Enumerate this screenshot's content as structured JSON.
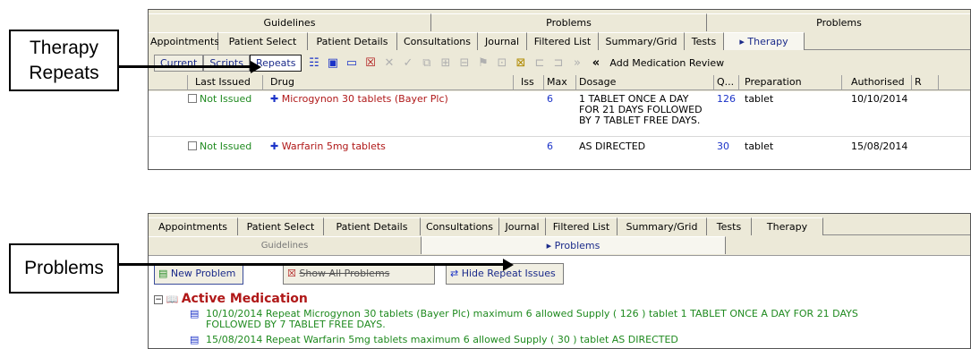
{
  "callouts": {
    "therapy_repeats": "Therapy Repeats",
    "problems": "Problems"
  },
  "top_panel": {
    "upper_tabs": [
      "Guidelines",
      "Problems",
      "Problems"
    ],
    "lower_tabs": [
      "Appointments",
      "Patient Select",
      "Patient Details",
      "Consultations",
      "Journal",
      "Filtered List",
      "Summary/Grid",
      "Tests",
      "▸ Therapy"
    ],
    "subtabs": {
      "current": "Current",
      "scripts": "Scripts",
      "repeats": "Repeats"
    },
    "add_review_label": "Add Medication Review",
    "columns": [
      "Last Issued",
      "Drug",
      "Iss",
      "Max",
      "Dosage",
      "Q...",
      "Preparation",
      "Authorised",
      "R"
    ],
    "rows": [
      {
        "status": "Not Issued",
        "drug": "Microgynon 30 tablets (Bayer Plc)",
        "max": "6",
        "dosage_lines": [
          "1 TABLET ONCE A DAY",
          "FOR 21 DAYS FOLLOWED",
          "BY 7 TABLET FREE DAYS."
        ],
        "quantity": "126",
        "preparation": "tablet",
        "authorised": "10/10/2014"
      },
      {
        "status": "Not Issued",
        "drug": "Warfarin 5mg tablets",
        "max": "6",
        "dosage_lines": [
          "AS DIRECTED"
        ],
        "quantity": "30",
        "preparation": "tablet",
        "authorised": "15/08/2014"
      }
    ]
  },
  "bottom_panel": {
    "tabs": [
      "Appointments",
      "Patient Select",
      "Patient Details",
      "Consultations",
      "Journal",
      "Filtered List",
      "Summary/Grid",
      "Tests",
      "Therapy"
    ],
    "second_row": {
      "guidelines": "Guidelines",
      "problems": "▸ Problems"
    },
    "buttons": {
      "new_problem": "New Problem",
      "show_all": "Show All Problems",
      "hide_repeat": "Hide Repeat Issues"
    },
    "section_title": "Active Medication",
    "entries": [
      {
        "line1": "10/10/2014 Repeat  Microgynon 30 tablets (Bayer Plc)  maximum  6  allowed  Supply ( 126 ) tablet  1 TABLET ONCE A DAY  FOR 21 DAYS",
        "line2": "FOLLOWED BY 7 TABLET FREE DAYS."
      },
      {
        "line1": "15/08/2014 Repeat  Warfarin 5mg tablets  maximum  6  allowed  Supply ( 30 ) tablet  AS DIRECTED",
        "line2": ""
      }
    ]
  }
}
